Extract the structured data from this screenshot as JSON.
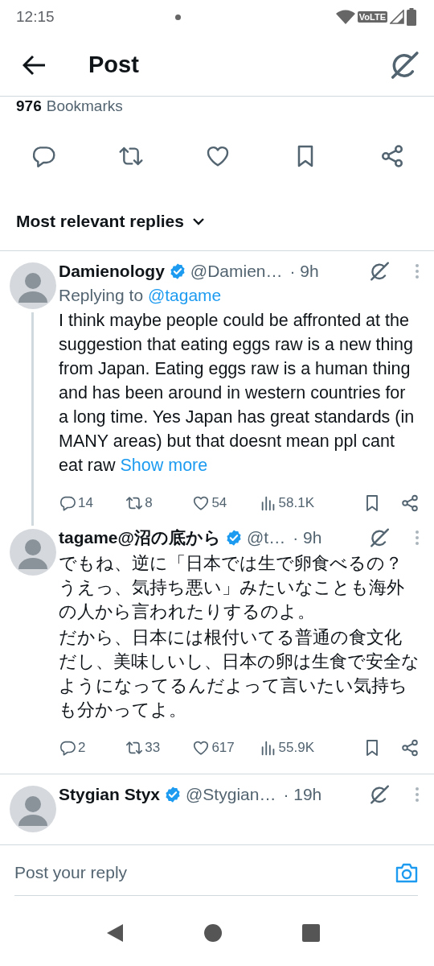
{
  "status_bar": {
    "time": "12:15",
    "network_label": "VoLTE"
  },
  "header": {
    "title": "Post"
  },
  "post_stats": {
    "bookmarks_count": "976",
    "bookmarks_label": "Bookmarks"
  },
  "sort": {
    "label": "Most relevant replies"
  },
  "replies": [
    {
      "name": "Damienology",
      "verified": true,
      "handle": "@Damien…",
      "time": "· 9h",
      "thread_line": true,
      "replying_to_label": "Replying to",
      "replying_to": "@tagame",
      "paragraphs": [
        "I think maybe people could be affronted at the suggestion that eating eggs raw is a new thing from Japan. Eating eggs raw is a human thing and has been around in western countries for a long time. Yes Japan has great standards (in MANY areas) but that doesnt mean ppl cant eat raw"
      ],
      "show_more": "Show more",
      "counts": {
        "replies": "14",
        "reposts": "8",
        "likes": "54",
        "views": "58.1K"
      }
    },
    {
      "name": "tagame@沼の底から",
      "verified": true,
      "handle": "@t…",
      "time": "· 9h",
      "thread_line": false,
      "paragraphs": [
        "でもね、逆に「日本では生で卵食べるの？うえっ、気持ち悪い」みたいなことも海外の人から言われたりするのよ。",
        "だから、日本には根付いてる普通の食文化だし、美味しいし、日本の卵は生食で安全なようになってるんだよって言いたい気持ちも分かってよ。"
      ],
      "counts": {
        "replies": "2",
        "reposts": "33",
        "likes": "617",
        "views": "55.9K"
      }
    },
    {
      "name": "Stygian Styx",
      "verified": true,
      "handle": "@Stygian…",
      "time": "· 19h",
      "thread_line": false
    }
  ],
  "composer": {
    "placeholder": "Post your reply"
  }
}
